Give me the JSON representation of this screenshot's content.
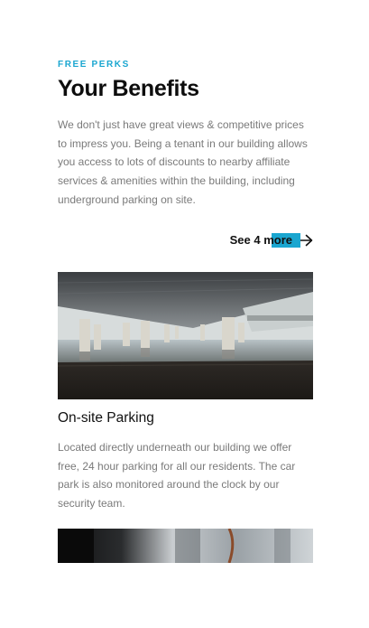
{
  "section": {
    "eyebrow": "FREE PERKS",
    "title": "Your Benefits",
    "intro": "We don't just have great views & competitive prices to impress you. Being a tenant in our building allows you access to lots of discounts to nearby affiliate services & amenities within the building, including underground parking on site.",
    "see_more_label": "See 4 more",
    "see_more_icon": "arrow-right-icon"
  },
  "benefits": [
    {
      "title": "On-site Parking",
      "description": "Located directly underneath our building we offer free, 24 hour parking for all our residents. The car park is also monitored around the clock by our security team."
    }
  ],
  "colors": {
    "accent": "#1aa6d0",
    "heading": "#0d0d0d",
    "body_text": "#7a7a7a"
  }
}
